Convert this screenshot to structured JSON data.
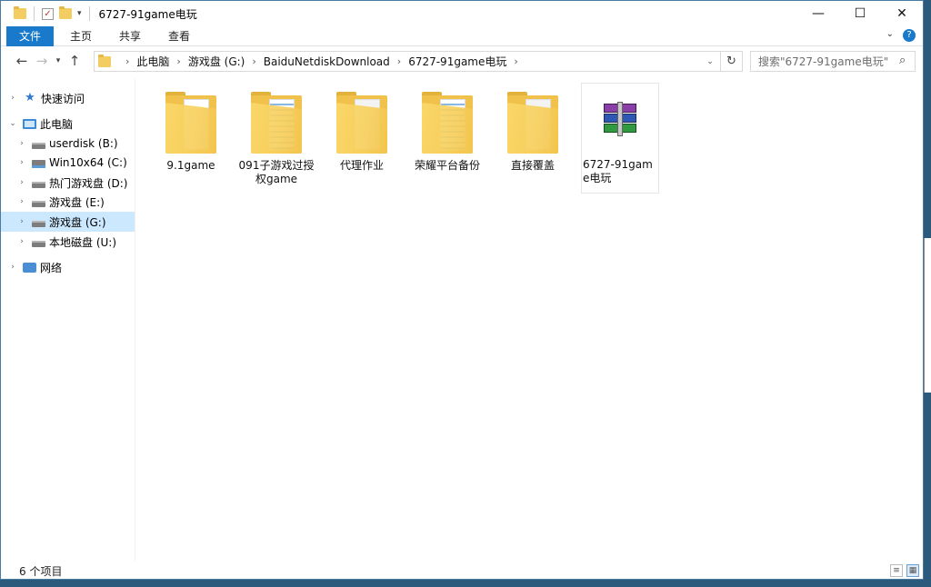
{
  "window": {
    "title": "6727-91game电玩"
  },
  "ribbon": {
    "tabs": [
      {
        "label": "文件"
      },
      {
        "label": "主页"
      },
      {
        "label": "共享"
      },
      {
        "label": "查看"
      }
    ]
  },
  "controls": {
    "minimize": "—",
    "maximize": "☐",
    "close": "✕"
  },
  "address": {
    "crumbs": [
      {
        "label": "此电脑"
      },
      {
        "label": "游戏盘 (G:)"
      },
      {
        "label": "BaiduNetdiskDownload"
      },
      {
        "label": "6727-91game电玩"
      }
    ]
  },
  "search": {
    "placeholder": "搜索\"6727-91game电玩\""
  },
  "navpane": {
    "items": [
      {
        "label": "快速访问",
        "icon": "star-icon"
      },
      {
        "label": "此电脑",
        "icon": "pc-icon"
      },
      {
        "label": "userdisk (B:)",
        "icon": "drive-icon"
      },
      {
        "label": "Win10x64 (C:)",
        "icon": "system-drive-icon"
      },
      {
        "label": "热门游戏盘 (D:)",
        "icon": "drive-icon"
      },
      {
        "label": "游戏盘 (E:)",
        "icon": "drive-icon"
      },
      {
        "label": "游戏盘 (G:)",
        "icon": "drive-icon"
      },
      {
        "label": "本地磁盘 (U:)",
        "icon": "drive-icon"
      },
      {
        "label": "网络",
        "icon": "network-icon"
      }
    ]
  },
  "files": [
    {
      "name": "9.1game",
      "type": "folder"
    },
    {
      "name": "091子游戏过授权game",
      "type": "folder"
    },
    {
      "name": "代理作业",
      "type": "folder"
    },
    {
      "name": "荣耀平台备份",
      "type": "folder"
    },
    {
      "name": "直接覆盖",
      "type": "folder"
    },
    {
      "name": "6727-91game电玩",
      "type": "rar-archive"
    }
  ],
  "status": {
    "item_count": "6 个项目"
  },
  "colors": {
    "accent": "#1979ca",
    "selection": "#cce8ff",
    "folder": "#f7cf5c"
  }
}
